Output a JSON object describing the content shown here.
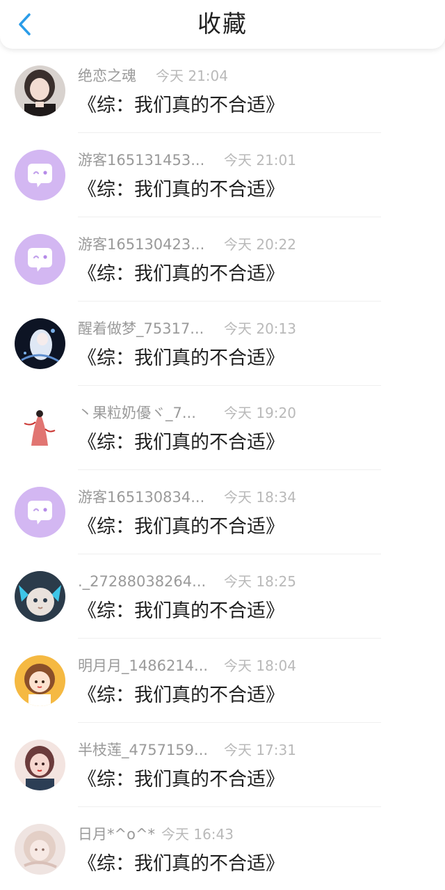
{
  "header": {
    "title": "收藏",
    "back_icon": "chevron-left-icon",
    "accent_color": "#2a9ce8"
  },
  "items": [
    {
      "user": "绝恋之魂",
      "time": "今天 21:04",
      "title": "《综：我们真的不合适》",
      "avatar": "photo-avatar"
    },
    {
      "user": "游客165131453...",
      "time": "今天 21:01",
      "title": "《综：我们真的不合适》",
      "avatar": "default-chat-bubble-avatar"
    },
    {
      "user": "游客165130423...",
      "time": "今天 20:22",
      "title": "《综：我们真的不合适》",
      "avatar": "default-chat-bubble-avatar"
    },
    {
      "user": "醒着做梦_75317...",
      "time": "今天 20:13",
      "title": "《综：我们真的不合适》",
      "avatar": "photo-avatar"
    },
    {
      "user": "丶果粒奶優ヾ_7...",
      "time": "今天 19:20",
      "title": "《综：我们真的不合适》",
      "avatar": "photo-avatar"
    },
    {
      "user": "游客165130834...",
      "time": "今天 18:34",
      "title": "《综：我们真的不合适》",
      "avatar": "default-chat-bubble-avatar"
    },
    {
      "user": "._27288038264...",
      "time": "今天 18:25",
      "title": "《综：我们真的不合适》",
      "avatar": "photo-avatar"
    },
    {
      "user": "明月月_1486214...",
      "time": "今天 18:04",
      "title": "《综：我们真的不合适》",
      "avatar": "cartoon-girl-avatar"
    },
    {
      "user": "半枝莲_4757159...",
      "time": "今天 17:31",
      "title": "《综：我们真的不合适》",
      "avatar": "photo-avatar"
    },
    {
      "user": "日月*^o^*",
      "time": "今天 16:43",
      "title": "《综：我们真的不合适》",
      "avatar": "photo-avatar"
    }
  ]
}
